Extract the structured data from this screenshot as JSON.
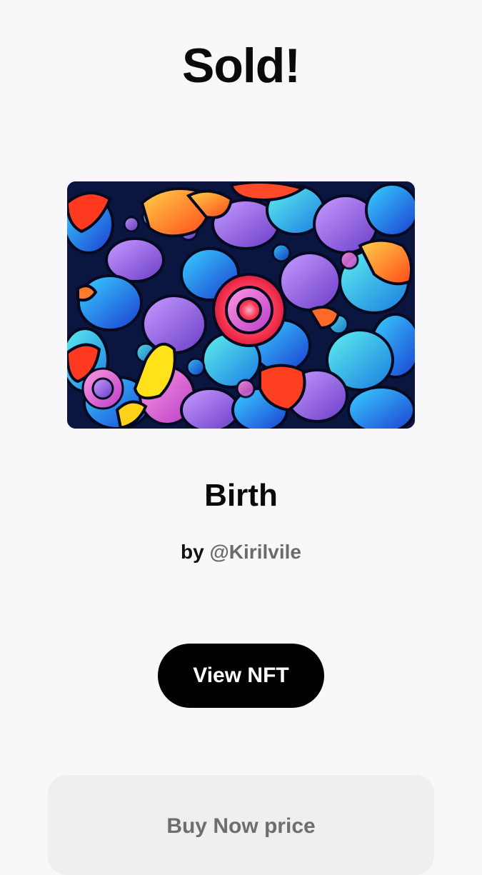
{
  "header": {
    "title": "Sold!"
  },
  "nft": {
    "name": "Birth",
    "by_prefix": "by",
    "creator_handle": "@Kirilvile",
    "image_icon": "abstract-stained-glass-artwork"
  },
  "actions": {
    "view_label": "View NFT"
  },
  "price_card": {
    "label": "Buy Now price"
  },
  "colors": {
    "background": "#f8f8fa",
    "button": "#000000",
    "button_text": "#ffffff",
    "card": "#efefef",
    "muted_text": "#6b6b6b"
  }
}
